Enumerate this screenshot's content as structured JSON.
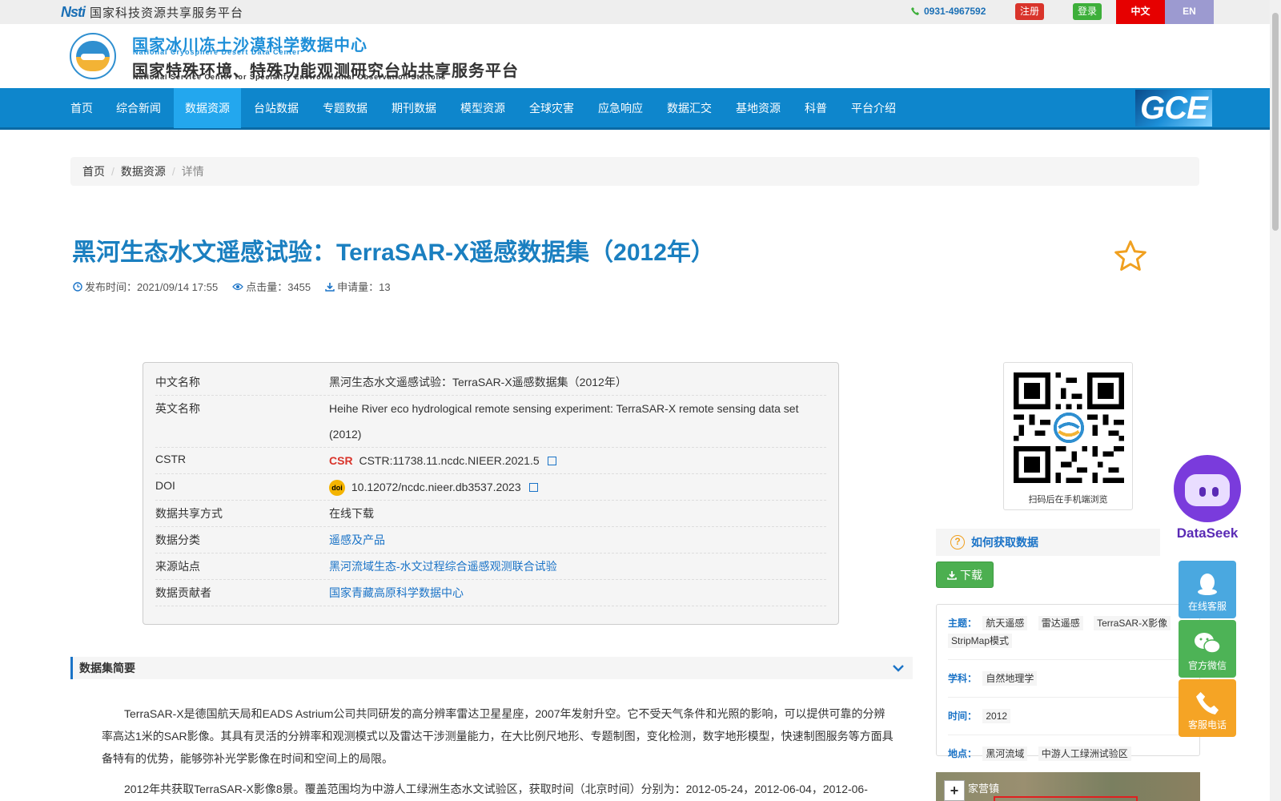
{
  "topbar": {
    "nsti_mark": "Nsti",
    "nsti_text": "国家科技资源共享服务平台",
    "phone": "0931-4967592",
    "register": "注册",
    "login": "登录",
    "lang_zh": "中文",
    "lang_en": "EN"
  },
  "header": {
    "title1": "国家冰川冻土沙漠科学数据中心",
    "subtitle1": "National Cryosphere Desert Data Center",
    "title2": "国家特殊环境、特殊功能观测研究台站共享服务平台",
    "subtitle2": "National Service Center for Speciality Environmental Observation Stations",
    "gce": "GCE"
  },
  "nav": {
    "items": [
      "首页",
      "综合新闻",
      "数据资源",
      "台站数据",
      "专题数据",
      "期刊数据",
      "模型资源",
      "全球灾害",
      "应急响应",
      "数据汇交",
      "基地资源",
      "科普",
      "平台介绍"
    ],
    "active_index": 2
  },
  "breadcrumb": [
    "首页",
    "数据资源",
    "详情"
  ],
  "dataset": {
    "title": "黑河生态水文遥感试验：TerraSAR-X遥感数据集（2012年）",
    "publish_label": "发布时间：2021/09/14 17:55",
    "clicks_label": "点击量：3455",
    "requests_label": "申请量：13"
  },
  "info": {
    "cn_name_key": "中文名称",
    "cn_name": "黑河生态水文遥感试验：TerraSAR-X遥感数据集（2012年）",
    "en_name_key": "英文名称",
    "en_name": "Heihe River eco hydrological remote sensing experiment: TerraSAR-X remote sensing data set (2012)",
    "cstr_key": "CSTR",
    "cstr_logo": "CSR",
    "cstr": "CSTR:11738.11.ncdc.NIEER.2021.5",
    "doi_key": "DOI",
    "doi_logo": "doi",
    "doi": "10.12072/ncdc.nieer.db3537.2023",
    "share_key": "数据共享方式",
    "share": "在线下载",
    "category_key": "数据分类",
    "category": "遥感及产品",
    "station_key": "来源站点",
    "station": "黑河流域生态-水文过程综合遥感观测联合试验",
    "contributor_key": "数据贡献者",
    "contributor": "国家青藏高原科学数据中心"
  },
  "qr": {
    "caption": "扫码后在手机端浏览"
  },
  "dataseek": {
    "label": "DataSeek"
  },
  "howto": {
    "icon": "?",
    "label": "如何获取数据"
  },
  "download": {
    "label": "下载"
  },
  "tags": {
    "theme_key": "主题：",
    "themes": [
      "航天遥感",
      "雷达遥感",
      "TerraSAR-X影像",
      "StripMap模式"
    ],
    "discipline_key": "学科：",
    "disciplines": [
      "自然地理学"
    ],
    "time_key": "时间：",
    "times": [
      "2012"
    ],
    "place_key": "地点：",
    "places": [
      "黑河流域",
      "中游人工绿洲试验区"
    ]
  },
  "service": {
    "online": "在线客服",
    "wechat": "官方微信",
    "phone": "客服电话"
  },
  "abstract": {
    "heading": "数据集简要",
    "p1": "TerraSAR-X是德国航天局和EADS Astrium公司共同研发的高分辨率雷达卫星星座，2007年发射升空。它不受天气条件和光照的影响，可以提供可靠的分辨率高达1米的SAR影像。其具有灵活的分辨率和观测模式以及雷达干涉测量能力，在大比例尺地形、专题制图，变化检测，数字地形模型，快速制图服务等方面具备特有的优势，能够弥补光学影像在时间和空间上的局限。",
    "p2": "2012年共获取TerraSAR-X影像8景。覆盖范围均为中游人工绿洲生态水文试验区，获取时间（北京时间）分别为：2012-05-24，2012-06-04，2012-06-"
  },
  "map": {
    "zoom_in": "+",
    "label": "家营镇"
  }
}
